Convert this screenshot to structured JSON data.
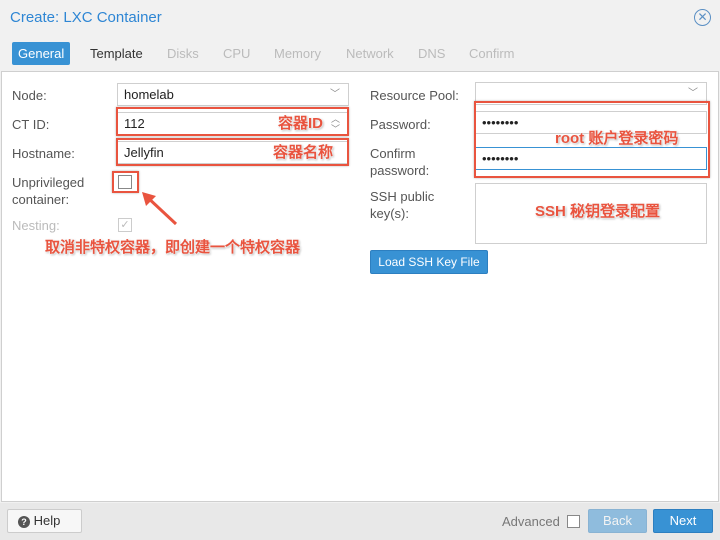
{
  "window": {
    "title": "Create: LXC Container"
  },
  "tabs": [
    {
      "label": "General"
    },
    {
      "label": "Template"
    },
    {
      "label": "Disks"
    },
    {
      "label": "CPU"
    },
    {
      "label": "Memory"
    },
    {
      "label": "Network"
    },
    {
      "label": "DNS"
    },
    {
      "label": "Confirm"
    }
  ],
  "form": {
    "node": {
      "label": "Node:",
      "value": "homelab"
    },
    "ctid": {
      "label": "CT ID:",
      "value": "112"
    },
    "hostname": {
      "label": "Hostname:",
      "value": "Jellyfin"
    },
    "unprivileged": {
      "label1": "Unprivileged",
      "label2": "container:",
      "checked": false
    },
    "nesting": {
      "label": "Nesting:",
      "checked": true
    },
    "pool": {
      "label": "Resource Pool:",
      "value": ""
    },
    "password": {
      "label": "Password:",
      "value": "••••••••"
    },
    "confirm": {
      "label1": "Confirm",
      "label2": "password:",
      "value": "••••••••"
    },
    "ssh": {
      "label1": "SSH public",
      "label2": "key(s):"
    },
    "load_ssh": "Load SSH Key File"
  },
  "annotations": {
    "ctid": "容器ID",
    "hostname": "容器名称",
    "unprivileged": "取消非特权容器，即创建一个特权容器",
    "password": "root 账户登录密码",
    "ssh": "SSH 秘钥登录配置"
  },
  "footer": {
    "help": "Help",
    "advanced": "Advanced",
    "back": "Back",
    "next": "Next"
  }
}
